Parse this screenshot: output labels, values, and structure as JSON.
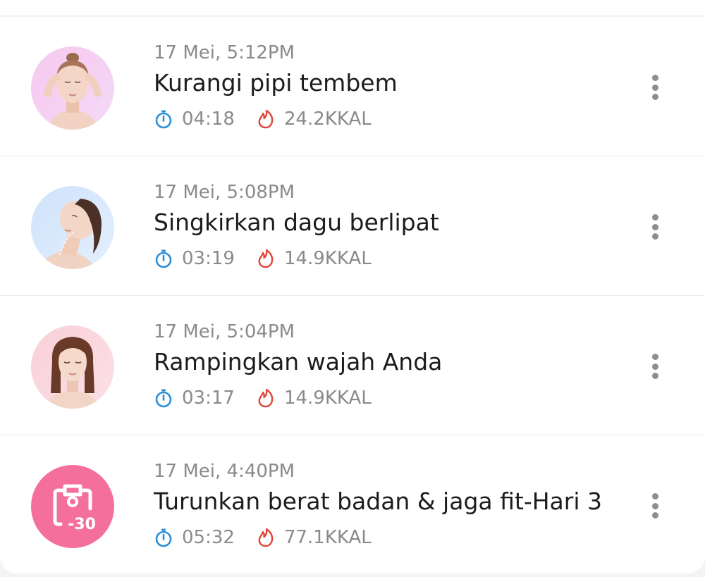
{
  "colors": {
    "timer_icon": "#2b8fd6",
    "flame_icon": "#e0453a",
    "challenge_badge": "#f56f9d",
    "title_text": "#1c1c1c",
    "meta_text": "#8a8a8a"
  },
  "history": {
    "items": [
      {
        "thumbnail_icon": "face-massage-thumbnail",
        "date": "17 Mei, 5:12PM",
        "title": "Kurangi pipi tembem",
        "duration": "04:18",
        "calories": "24.2KKAL"
      },
      {
        "thumbnail_icon": "chin-lift-thumbnail",
        "date": "17 Mei, 5:08PM",
        "title": "Singkirkan dagu berlipat",
        "duration": "03:19",
        "calories": "14.9KKAL"
      },
      {
        "thumbnail_icon": "face-slim-thumbnail",
        "date": "17 Mei, 5:04PM",
        "title": "Rampingkan wajah Anda",
        "duration": "03:17",
        "calories": "14.9KKAL"
      },
      {
        "thumbnail_icon": "clipboard-30-icon",
        "badge_label": "-30",
        "date": "17 Mei, 4:40PM",
        "title": "Turunkan berat badan & jaga fit-Hari 3",
        "duration": "05:32",
        "calories": "77.1KKAL"
      }
    ]
  }
}
